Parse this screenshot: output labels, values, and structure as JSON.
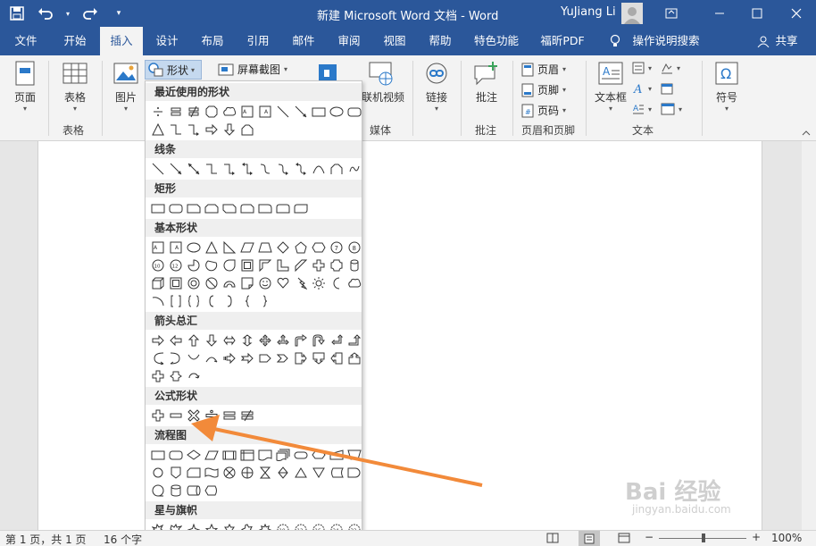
{
  "titlebar": {
    "title": "新建 Microsoft Word 文档  -  Word",
    "user": "YuJiang Li"
  },
  "tabs": [
    {
      "label": "文件"
    },
    {
      "label": "开始"
    },
    {
      "label": "插入"
    },
    {
      "label": "设计"
    },
    {
      "label": "布局"
    },
    {
      "label": "引用"
    },
    {
      "label": "邮件"
    },
    {
      "label": "审阅"
    },
    {
      "label": "视图"
    },
    {
      "label": "帮助"
    },
    {
      "label": "特色功能"
    },
    {
      "label": "福昕PDF"
    }
  ],
  "tell_me": "操作说明搜索",
  "share": "共享",
  "ribbon": {
    "pages": "页面",
    "table": "表格",
    "table_group": "表格",
    "picture": "图片",
    "shapes": "形状",
    "screenshot": "屏幕截图",
    "online_video": "联机视频",
    "media_group": "媒体",
    "link": "链接",
    "comment": "批注",
    "comment_group": "批注",
    "header": "页眉",
    "footer": "页脚",
    "page_number": "页码",
    "header_footer_group": "页眉和页脚",
    "textbox": "文本框",
    "text_group": "文本",
    "symbol": "符号",
    "omega": "Ω"
  },
  "shapes_menu": {
    "sections": [
      {
        "label": "最近使用的形状"
      },
      {
        "label": "线条"
      },
      {
        "label": "矩形"
      },
      {
        "label": "基本形状"
      },
      {
        "label": "箭头总汇"
      },
      {
        "label": "公式形状"
      },
      {
        "label": "流程图"
      },
      {
        "label": "星与旗帜"
      }
    ]
  },
  "statusbar": {
    "page": "第 1 页，共 1 页",
    "words": "16 个字",
    "zoom": "100%"
  },
  "watermark": {
    "logo": "Bai 经验",
    "url": "jingyan.baidu.com"
  },
  "colors": {
    "brand": "#2b579a",
    "annotation_arrow": "#f28a3a"
  }
}
